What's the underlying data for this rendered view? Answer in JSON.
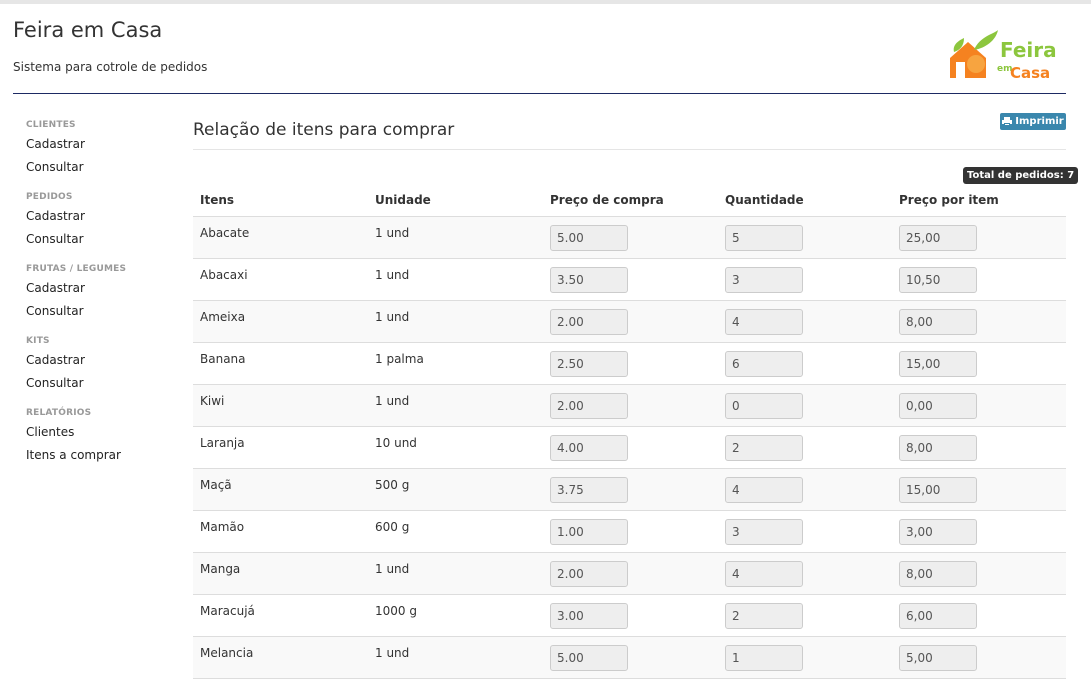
{
  "header": {
    "title": "Feira em Casa",
    "subtitle": "Sistema para cotrole de pedidos",
    "logo": {
      "line1": "Feira",
      "em": "em",
      "line2": "Casa"
    }
  },
  "sidebar": {
    "sections": [
      {
        "heading": "CLIENTES",
        "items": [
          "Cadastrar",
          "Consultar"
        ]
      },
      {
        "heading": "PEDIDOS",
        "items": [
          "Cadastrar",
          "Consultar"
        ]
      },
      {
        "heading": "FRUTAS / LEGUMES",
        "items": [
          "Cadastrar",
          "Consultar"
        ]
      },
      {
        "heading": "KITS",
        "items": [
          "Cadastrar",
          "Consultar"
        ]
      },
      {
        "heading": "RELATÓRIOS",
        "items": [
          "Clientes",
          "Itens a comprar"
        ]
      }
    ]
  },
  "main": {
    "title": "Relação de itens para comprar",
    "print_label": "Imprimir",
    "total_label": "Total de pedidos: 7"
  },
  "table": {
    "headers": [
      "Itens",
      "Unidade",
      "Preço de compra",
      "Quantidade",
      "Preço por item"
    ],
    "rows": [
      [
        "Abacate",
        "1 und",
        "5.00",
        "5",
        "25,00"
      ],
      [
        "Abacaxi",
        "1 und",
        "3.50",
        "3",
        "10,50"
      ],
      [
        "Ameixa",
        "1 und",
        "2.00",
        "4",
        "8,00"
      ],
      [
        "Banana",
        "1 palma",
        "2.50",
        "6",
        "15,00"
      ],
      [
        "Kiwi",
        "1 und",
        "2.00",
        "0",
        "0,00"
      ],
      [
        "Laranja",
        "10 und",
        "4.00",
        "2",
        "8,00"
      ],
      [
        "Maçã",
        "500 g",
        "3.75",
        "4",
        "15,00"
      ],
      [
        "Mamão",
        "600 g",
        "1.00",
        "3",
        "3,00"
      ],
      [
        "Manga",
        "1 und",
        "2.00",
        "4",
        "8,00"
      ],
      [
        "Maracujá",
        "1000 g",
        "3.00",
        "2",
        "6,00"
      ],
      [
        "Melancia",
        "1 und",
        "5.00",
        "1",
        "5,00"
      ]
    ]
  }
}
